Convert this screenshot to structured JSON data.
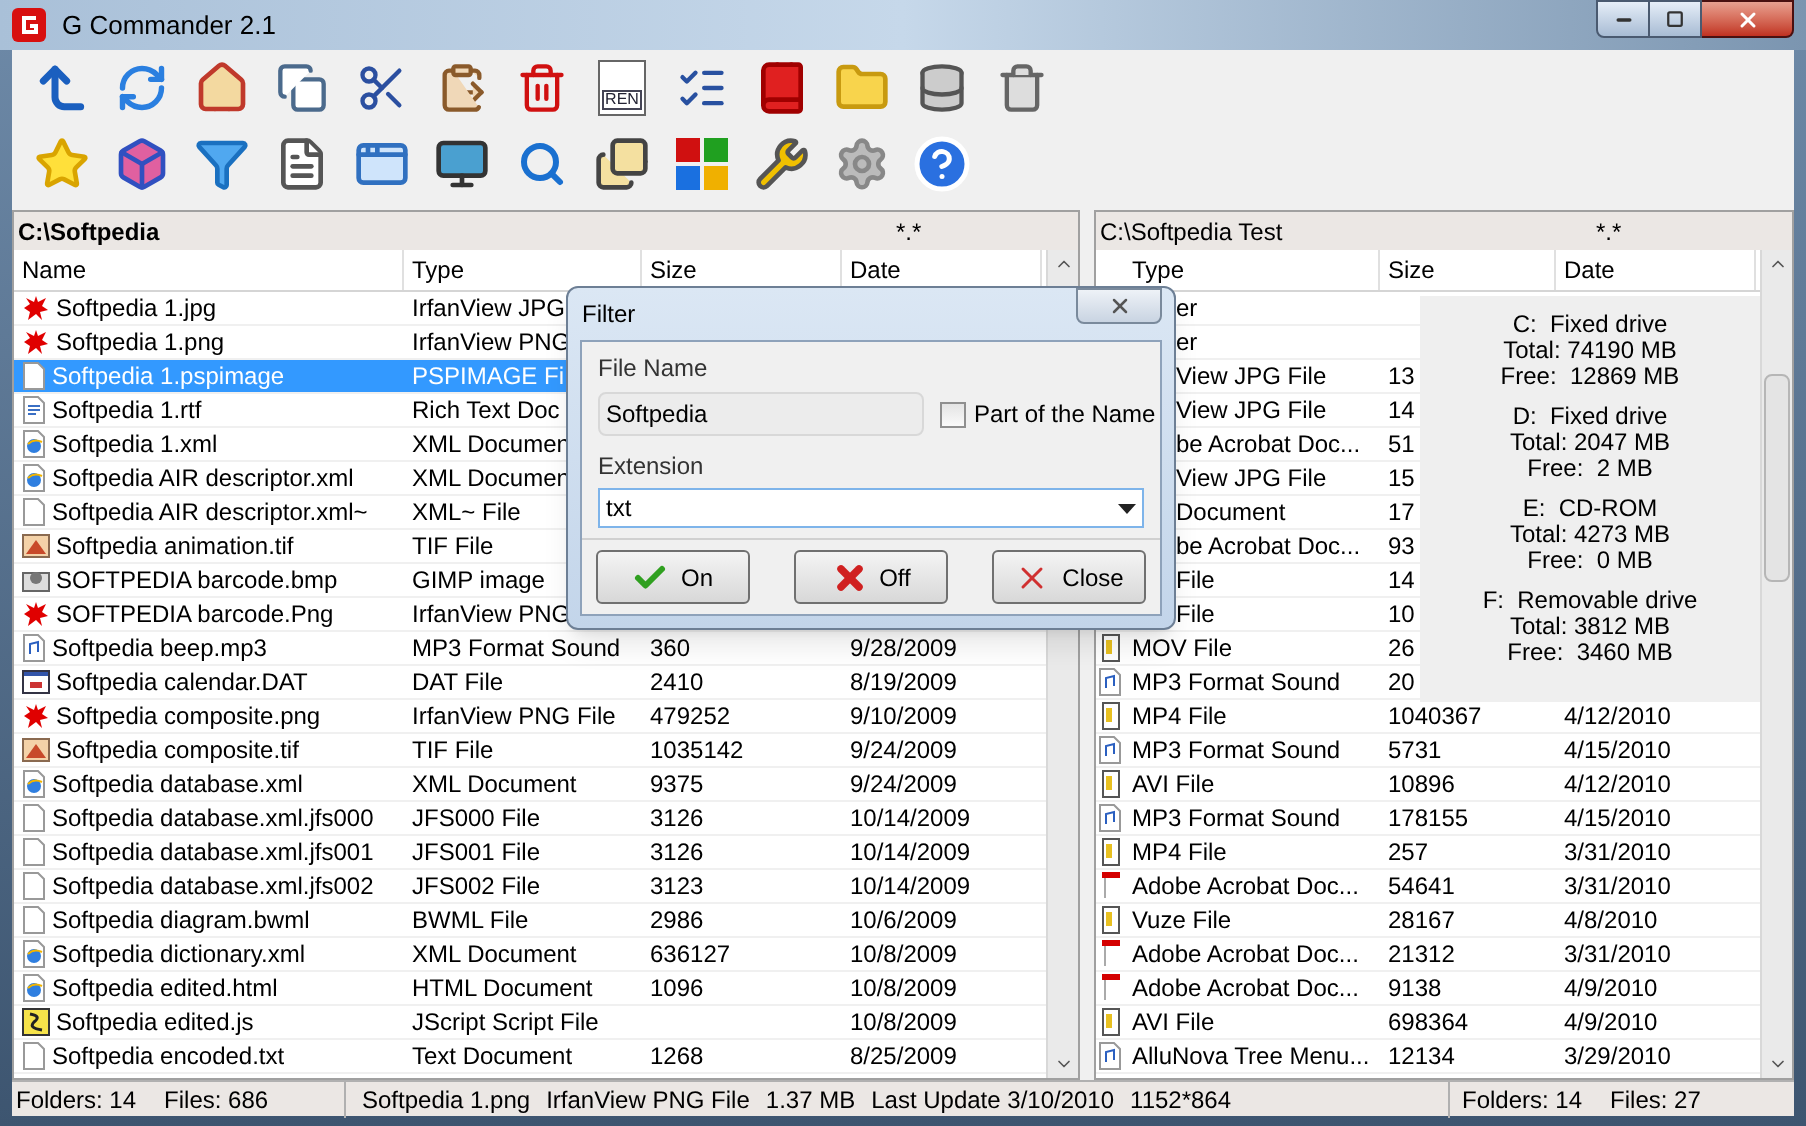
{
  "window": {
    "title": "G Commander 2.1"
  },
  "toolbar": {
    "rename_label": "REN"
  },
  "left_panel": {
    "path": "C:\\Softpedia",
    "mask": "*.*",
    "columns": [
      "Name",
      "Type",
      "Size",
      "Date"
    ],
    "rows": [
      {
        "kind": "irfan",
        "name": "Softpedia 1.jpg",
        "type": "IrfanView JPG",
        "selected": false
      },
      {
        "kind": "irfan",
        "name": "Softpedia 1.png",
        "type": "IrfanView PNG",
        "selected": false
      },
      {
        "kind": "blank",
        "name": "Softpedia 1.pspimage",
        "type": "PSPIMAGE Fi",
        "selected": true
      },
      {
        "kind": "rtf",
        "name": "Softpedia 1.rtf",
        "type": "Rich Text Doc",
        "selected": false
      },
      {
        "kind": "xml",
        "name": "Softpedia 1.xml",
        "type": "XML Documen",
        "selected": false
      },
      {
        "kind": "xml",
        "name": "Softpedia AIR descriptor.xml",
        "type": "XML Documen",
        "selected": false
      },
      {
        "kind": "blank",
        "name": "Softpedia AIR descriptor.xml~",
        "type": "XML~ File",
        "selected": false
      },
      {
        "kind": "tif",
        "name": "Softpedia animation.tif",
        "type": "TIF File",
        "selected": false
      },
      {
        "kind": "gimp",
        "name": "SOFTPEDIA barcode.bmp",
        "type": "GIMP image",
        "selected": false
      },
      {
        "kind": "irfan",
        "name": "SOFTPEDIA barcode.Png",
        "type": "IrfanView PNG",
        "selected": false
      },
      {
        "kind": "mp3",
        "name": "Softpedia beep.mp3",
        "type": "MP3 Format Sound",
        "size": "360",
        "date": "9/28/2009",
        "selected": false
      },
      {
        "kind": "dat",
        "name": "Softpedia calendar.DAT",
        "type": "DAT File",
        "size": "2410",
        "date": "8/19/2009",
        "selected": false
      },
      {
        "kind": "irfan",
        "name": "Softpedia composite.png",
        "type": "IrfanView PNG File",
        "size": "479252",
        "date": "9/10/2009",
        "selected": false
      },
      {
        "kind": "tif",
        "name": "Softpedia composite.tif",
        "type": "TIF File",
        "size": "1035142",
        "date": "9/24/2009",
        "selected": false
      },
      {
        "kind": "xml",
        "name": "Softpedia database.xml",
        "type": "XML Document",
        "size": "9375",
        "date": "9/24/2009",
        "selected": false
      },
      {
        "kind": "blank",
        "name": "Softpedia database.xml.jfs000",
        "type": "JFS000 File",
        "size": "3126",
        "date": "10/14/2009",
        "selected": false
      },
      {
        "kind": "blank",
        "name": "Softpedia database.xml.jfs001",
        "type": "JFS001 File",
        "size": "3126",
        "date": "10/14/2009",
        "selected": false
      },
      {
        "kind": "blank",
        "name": "Softpedia database.xml.jfs002",
        "type": "JFS002 File",
        "size": "3123",
        "date": "10/14/2009",
        "selected": false
      },
      {
        "kind": "blank",
        "name": "Softpedia diagram.bwml",
        "type": "BWML File",
        "size": "2986",
        "date": "10/6/2009",
        "selected": false
      },
      {
        "kind": "xml",
        "name": "Softpedia dictionary.xml",
        "type": "XML Document",
        "size": "636127",
        "date": "10/8/2009",
        "selected": false
      },
      {
        "kind": "html",
        "name": "Softpedia edited.html",
        "type": "HTML Document",
        "size": "1096",
        "date": "10/8/2009",
        "selected": false
      },
      {
        "kind": "js",
        "name": "Softpedia edited.js",
        "type": "JScript Script File",
        "date": "10/8/2009",
        "selected": false
      },
      {
        "kind": "txt",
        "name": "Softpedia encoded.txt",
        "type": "Text Document",
        "size": "1268",
        "date": "8/25/2009",
        "selected": false
      }
    ]
  },
  "right_panel": {
    "path": "C:\\Softpedia Test",
    "mask": "*.*",
    "columns": [
      "Type",
      "Size",
      "Date"
    ],
    "rows": [
      {
        "kind": "hidden",
        "type": "er"
      },
      {
        "kind": "hidden",
        "type": "er"
      },
      {
        "kind": "hidden",
        "type": "View JPG File",
        "size": "13"
      },
      {
        "kind": "hidden",
        "type": "View JPG File",
        "size": "14"
      },
      {
        "kind": "hidden",
        "type": "be Acrobat Doc...",
        "size": "51"
      },
      {
        "kind": "hidden",
        "type": "View JPG File",
        "size": "15"
      },
      {
        "kind": "hidden",
        "type": "Document",
        "size": "17"
      },
      {
        "kind": "hidden",
        "type": "be Acrobat Doc...",
        "size": "93"
      },
      {
        "kind": "hidden",
        "type": "File",
        "size": "14"
      },
      {
        "kind": "hidden",
        "type": "File",
        "size": "10"
      },
      {
        "kind": "media",
        "type": "MOV File",
        "size": "26"
      },
      {
        "kind": "sound",
        "type": "MP3 Format Sound",
        "size": "20"
      },
      {
        "kind": "media",
        "type": "MP4 File",
        "size": "1040367",
        "date": "4/12/2010"
      },
      {
        "kind": "sound",
        "type": "MP3 Format Sound",
        "size": "5731",
        "date": "4/15/2010"
      },
      {
        "kind": "media",
        "type": "AVI File",
        "size": "10896",
        "date": "4/12/2010"
      },
      {
        "kind": "sound",
        "type": "MP3 Format Sound",
        "size": "178155",
        "date": "4/15/2010"
      },
      {
        "kind": "media",
        "type": "MP4 File",
        "size": "257",
        "date": "3/31/2010"
      },
      {
        "kind": "pdf",
        "type": "Adobe Acrobat Doc...",
        "size": "54641",
        "date": "3/31/2010"
      },
      {
        "kind": "media",
        "type": "Vuze File",
        "size": "28167",
        "date": "4/8/2010"
      },
      {
        "kind": "pdf",
        "type": "Adobe Acrobat Doc...",
        "size": "21312",
        "date": "3/31/2010"
      },
      {
        "kind": "pdf",
        "type": "Adobe Acrobat Doc...",
        "size": "9138",
        "date": "4/9/2010"
      },
      {
        "kind": "media",
        "type": "AVI File",
        "size": "698364",
        "date": "4/9/2010"
      },
      {
        "kind": "sound",
        "type": "AlluNova Tree Menu...",
        "size": "12134",
        "date": "3/29/2010"
      }
    ],
    "drives": [
      {
        "name": "C:  Fixed drive",
        "total": "Total: 74190 MB",
        "free": "Free:  12869 MB"
      },
      {
        "name": "D:  Fixed drive",
        "total": "Total: 2047 MB",
        "free": "Free:  2 MB"
      },
      {
        "name": "E:  CD-ROM",
        "total": "Total: 4273 MB",
        "free": "Free:  0 MB"
      },
      {
        "name": "F:  Removable drive",
        "total": "Total: 3812 MB",
        "free": "Free:  3460 MB"
      }
    ]
  },
  "filter_dialog": {
    "title": "Filter",
    "file_name_label": "File Name",
    "file_name_value": "Softpedia",
    "part_of_name": {
      "label": "Part of the Name",
      "checked": false
    },
    "extension_label": "Extension",
    "extension_value": "txt",
    "buttons": [
      {
        "kind": "on",
        "label": "On"
      },
      {
        "kind": "off",
        "label": "Off"
      },
      {
        "kind": "close",
        "label": "Close"
      }
    ]
  },
  "status_bar": {
    "left": [
      "Folders: 14",
      "Files: 686"
    ],
    "middle": [
      "Softpedia 1.png",
      "IrfanView PNG File",
      "1.37 MB",
      "Last Update 3/10/2010",
      "1152*864"
    ],
    "right": [
      "Folders: 14",
      "Files: 27"
    ]
  }
}
